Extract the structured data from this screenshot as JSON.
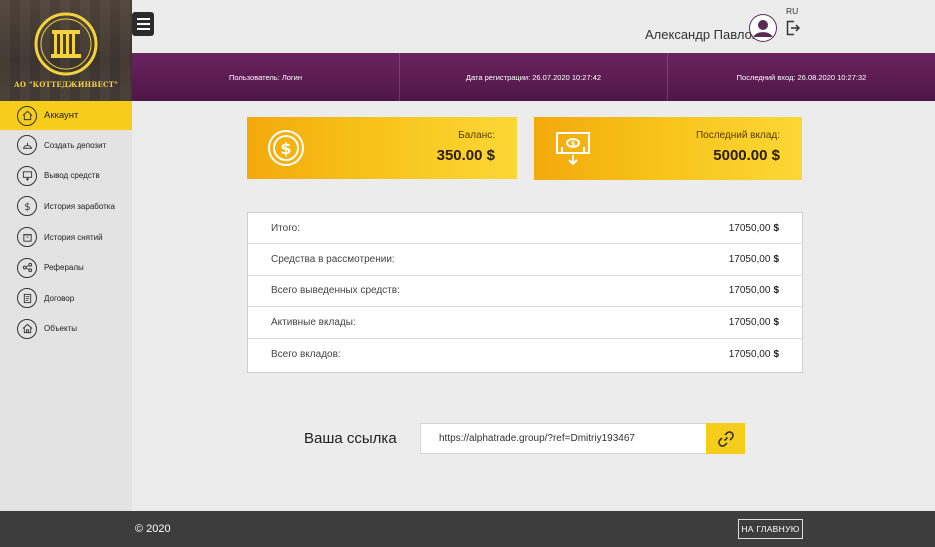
{
  "brand": {
    "logo_text": "АО \"КОТТЕДЖИНВЕСТ\""
  },
  "sidebar": {
    "items": [
      {
        "label": "Аккаунт",
        "icon": "home-icon",
        "active": true
      },
      {
        "label": "Создать депозит",
        "icon": "deposit-icon"
      },
      {
        "label": "Вывод средств",
        "icon": "withdraw-icon"
      },
      {
        "label": "История заработка",
        "icon": "dollar-icon"
      },
      {
        "label": "История снятий",
        "icon": "box-icon"
      },
      {
        "label": "Рефералы",
        "icon": "share-icon"
      },
      {
        "label": "Договор",
        "icon": "document-icon"
      },
      {
        "label": "Объекты",
        "icon": "house-icon"
      }
    ]
  },
  "header": {
    "username": "Александр Павлов",
    "lang": "RU"
  },
  "infobar": {
    "user": "Пользователь: Логин",
    "registered": "Дата регистрации: 26.07.2020 10:27:42",
    "last_login": "Последний вход: 26.08.2020 10:27:32"
  },
  "cards": {
    "balance": {
      "label": "Баланс:",
      "value": "350.00 $"
    },
    "last_deposit": {
      "label": "Последний вклад:",
      "value": "5000.00 $"
    }
  },
  "stats": {
    "rows": [
      {
        "label": "Итого:",
        "value": "17050,00",
        "unit": "$"
      },
      {
        "label": "Средства в рассмотрении:",
        "value": "17050,00",
        "unit": "$"
      },
      {
        "label": "Всего выведенных средств:",
        "value": "17050,00",
        "unit": "$"
      },
      {
        "label": "Активные вклады:",
        "value": "17050,00",
        "unit": "$"
      },
      {
        "label": "Всего вкладов:",
        "value": "17050,00",
        "unit": "$"
      }
    ]
  },
  "referral": {
    "label": "Ваша ссылка",
    "url": "https://alphatrade.group/?ref=Dmitriy193467"
  },
  "footer": {
    "copyright": "© 2020",
    "home_button": "НА ГЛАВНУЮ"
  },
  "colors": {
    "accent": "#f7cd1c",
    "infobar": "#5e1d55",
    "footer": "#3d3d3d"
  }
}
